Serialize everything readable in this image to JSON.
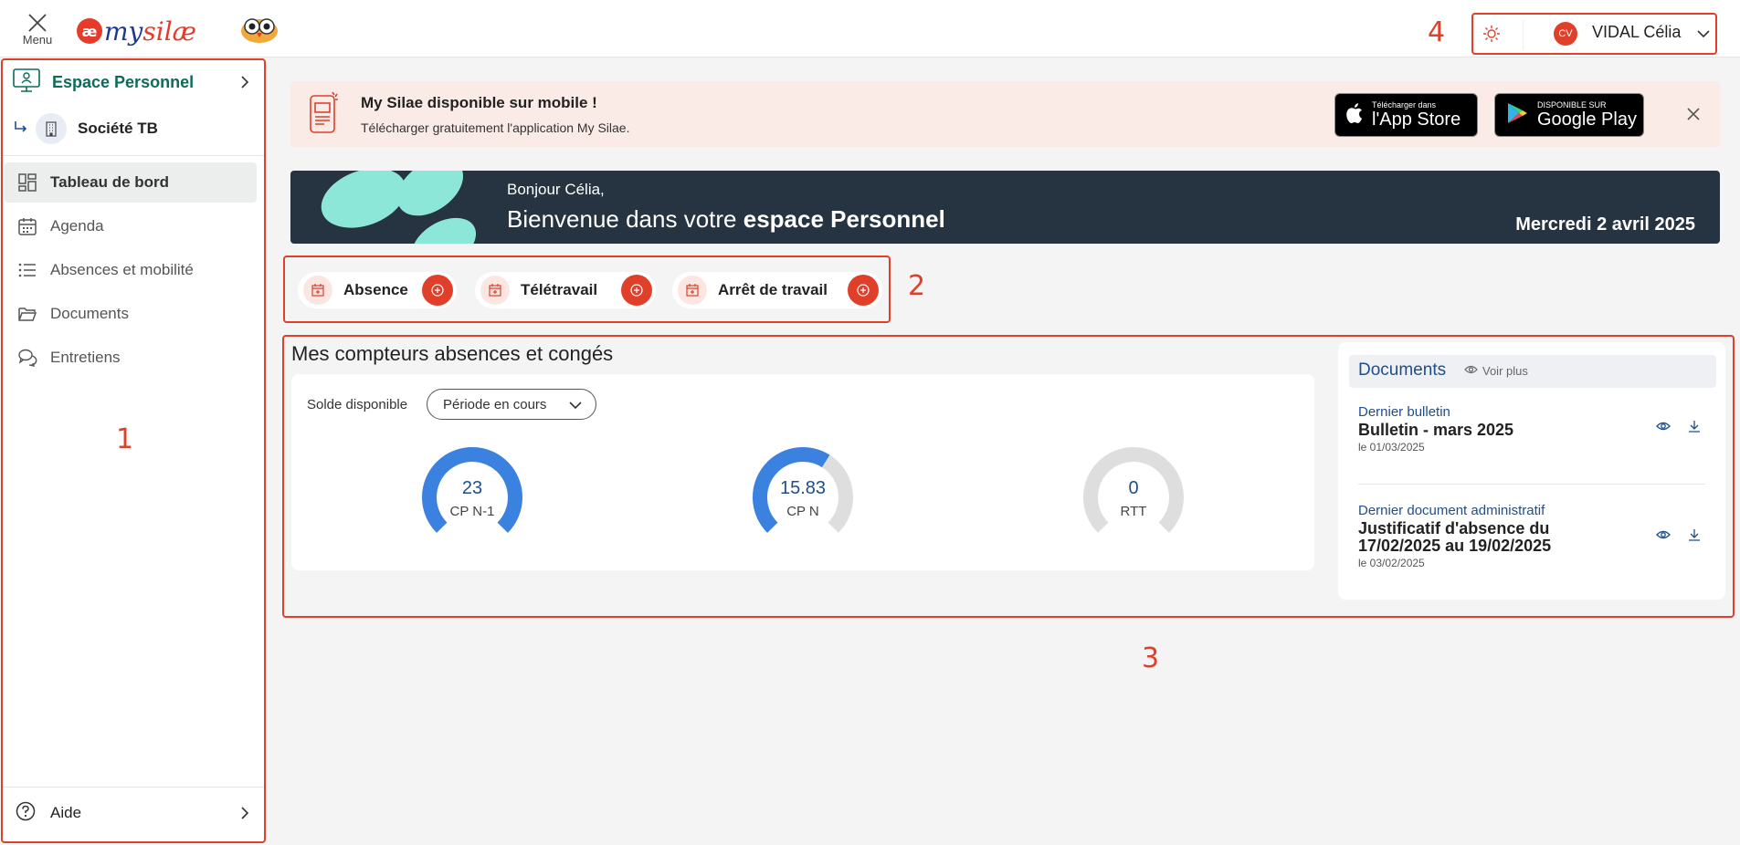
{
  "topbar": {
    "menu_label": "Menu",
    "logo_prefix": "æ",
    "logo_my": "my",
    "logo_silae": "silæ",
    "user_initials": "CV",
    "user_name": "VIDAL Célia"
  },
  "annotations": [
    "1",
    "2",
    "3",
    "4"
  ],
  "sidebar": {
    "space_title": "Espace Personnel",
    "company": "Société TB",
    "items": [
      {
        "label": "Tableau de bord",
        "icon": "dashboard-icon",
        "active": true
      },
      {
        "label": "Agenda",
        "icon": "calendar-icon",
        "active": false
      },
      {
        "label": "Absences et mobilité",
        "icon": "list-icon",
        "active": false
      },
      {
        "label": "Documents",
        "icon": "folder-icon",
        "active": false
      },
      {
        "label": "Entretiens",
        "icon": "chat-icon",
        "active": false
      }
    ],
    "help": "Aide"
  },
  "banner": {
    "title": "My Silae disponible sur mobile !",
    "subtitle": "Télécharger gratuitement l'application My Silae.",
    "appstore_small": "Télécharger dans",
    "appstore_big": "l'App Store",
    "gplay_small": "DISPONIBLE SUR",
    "gplay_big": "Google Play"
  },
  "welcome": {
    "greeting": "Bonjour Célia,",
    "line_prefix": "Bienvenue dans votre ",
    "line_bold": "espace Personnel",
    "date": "Mercredi 2 avril 2025"
  },
  "quick_actions": [
    {
      "label": "Absence"
    },
    {
      "label": "Télétravail"
    },
    {
      "label": "Arrêt de travail"
    }
  ],
  "counters": {
    "title": "Mes compteurs absences et congés",
    "solde_label": "Solde disponible",
    "period": "Période en cours",
    "gauges": [
      {
        "value": "23",
        "label": "CP N-1",
        "fill": 1.0
      },
      {
        "value": "15.83",
        "label": "CP N",
        "fill": 0.62
      },
      {
        "value": "0",
        "label": "RTT",
        "fill": 0.0
      }
    ]
  },
  "documents": {
    "title": "Documents",
    "more": "Voir plus",
    "items": [
      {
        "category": "Dernier bulletin",
        "name": "Bulletin - mars 2025",
        "date": "le 01/03/2025"
      },
      {
        "category": "Dernier document administratif",
        "name": "Justificatif d'absence du 17/02/2025 au 19/02/2025",
        "date": "le 03/02/2025"
      }
    ]
  },
  "colors": {
    "accent": "#e0402a",
    "brand_navy": "#263341",
    "gauge_blue": "#3b82e0",
    "gauge_grey": "#dedede",
    "link_blue": "#1f4e8c",
    "teal": "#0f6b5a"
  }
}
